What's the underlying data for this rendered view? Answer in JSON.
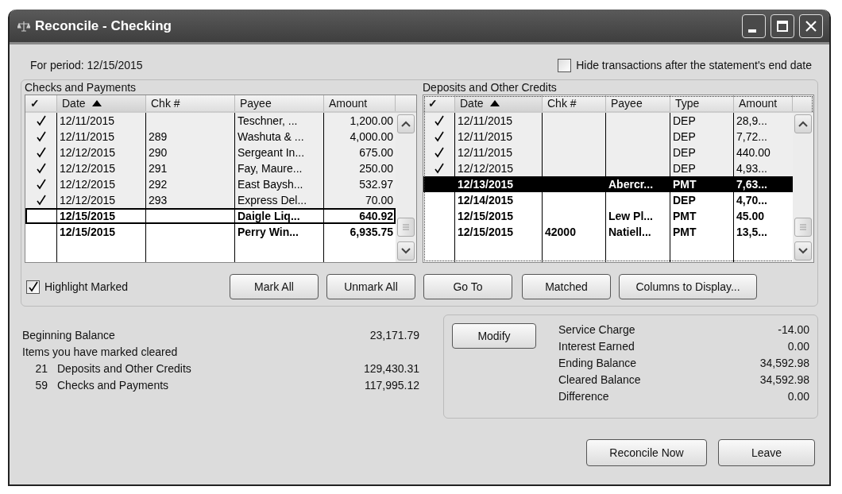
{
  "window": {
    "title": "Reconcile - Checking"
  },
  "period": "For period: 12/15/2015",
  "hide_option": {
    "label": "Hide transactions after the statement's end date",
    "checked": false
  },
  "checks_table": {
    "title": "Checks and Payments",
    "columns": [
      {
        "label": "✓",
        "sorted": false
      },
      {
        "label": "Date",
        "sorted": true
      },
      {
        "label": "Chk #",
        "sorted": false
      },
      {
        "label": "Payee",
        "sorted": false
      },
      {
        "label": "Amount",
        "sorted": false
      }
    ],
    "rows": [
      {
        "cleared": true,
        "selected": false,
        "focused": false,
        "cells": [
          "",
          "12/11/2015",
          "",
          "Teschner, ...",
          "1,200.00"
        ]
      },
      {
        "cleared": true,
        "selected": false,
        "focused": false,
        "cells": [
          "",
          "12/11/2015",
          "289",
          "Washuta & ...",
          "4,000.00"
        ]
      },
      {
        "cleared": true,
        "selected": false,
        "focused": false,
        "cells": [
          "",
          "12/12/2015",
          "290",
          "Sergeant In...",
          "675.00"
        ]
      },
      {
        "cleared": true,
        "selected": false,
        "focused": false,
        "cells": [
          "",
          "12/12/2015",
          "291",
          "Fay, Maure...",
          "250.00"
        ]
      },
      {
        "cleared": true,
        "selected": false,
        "focused": false,
        "cells": [
          "",
          "12/12/2015",
          "292",
          "East Baysh...",
          "532.97"
        ]
      },
      {
        "cleared": true,
        "selected": false,
        "focused": false,
        "cells": [
          "",
          "12/12/2015",
          "293",
          "Express Del...",
          "70.00"
        ]
      },
      {
        "cleared": false,
        "selected": false,
        "focused": true,
        "cells": [
          "",
          "12/15/2015",
          "",
          "Daigle Liq...",
          "640.92"
        ]
      },
      {
        "cleared": false,
        "selected": false,
        "focused": false,
        "cells": [
          "",
          "12/15/2015",
          "",
          "Perry Win...",
          "6,935.75"
        ]
      }
    ]
  },
  "deposits_table": {
    "title": "Deposits and Other Credits",
    "columns": [
      {
        "label": "✓",
        "sorted": false
      },
      {
        "label": "Date",
        "sorted": true
      },
      {
        "label": "Chk #",
        "sorted": false
      },
      {
        "label": "Payee",
        "sorted": false
      },
      {
        "label": "Type",
        "sorted": false
      },
      {
        "label": "Amount",
        "sorted": false
      }
    ],
    "rows": [
      {
        "cleared": true,
        "selected": false,
        "focused": false,
        "cells": [
          "",
          "12/11/2015",
          "",
          "",
          "DEP",
          "28,9..."
        ]
      },
      {
        "cleared": true,
        "selected": false,
        "focused": false,
        "cells": [
          "",
          "12/11/2015",
          "",
          "",
          "DEP",
          "7,72..."
        ]
      },
      {
        "cleared": true,
        "selected": false,
        "focused": false,
        "cells": [
          "",
          "12/11/2015",
          "",
          "",
          "DEP",
          "440.00"
        ]
      },
      {
        "cleared": true,
        "selected": false,
        "focused": false,
        "cells": [
          "",
          "12/12/2015",
          "",
          "",
          "DEP",
          "4,93..."
        ]
      },
      {
        "cleared": false,
        "selected": true,
        "focused": false,
        "cells": [
          "",
          "12/13/2015",
          "",
          "Abercr...",
          "PMT",
          "7,63..."
        ]
      },
      {
        "cleared": false,
        "selected": false,
        "focused": false,
        "cells": [
          "",
          "12/14/2015",
          "",
          "",
          "DEP",
          "4,70..."
        ]
      },
      {
        "cleared": false,
        "selected": false,
        "focused": false,
        "cells": [
          "",
          "12/15/2015",
          "",
          "Lew Pl...",
          "PMT",
          "45.00"
        ]
      },
      {
        "cleared": false,
        "selected": false,
        "focused": false,
        "cells": [
          "",
          "12/15/2015",
          "42000",
          "Natiell...",
          "PMT",
          "13,5..."
        ]
      }
    ]
  },
  "highlight_option": {
    "label": "Highlight Marked",
    "checked": true
  },
  "table_buttons": [
    "Mark All",
    "Unmark All",
    "Go To",
    "Matched",
    "Columns to Display..."
  ],
  "summary": {
    "beginning": {
      "label": "Beginning Balance",
      "value": "23,171.79"
    },
    "marked_heading": "Items you have marked cleared",
    "items": [
      {
        "count": "21",
        "label": "Deposits and Other Credits",
        "value": "129,430.31"
      },
      {
        "count": "59",
        "label": "Checks and Payments",
        "value": "117,995.12"
      }
    ]
  },
  "balances": {
    "button": "Modify",
    "rows": [
      {
        "label": "Service Charge",
        "value": "-14.00"
      },
      {
        "label": "Interest Earned",
        "value": "0.00"
      },
      {
        "label": "Ending Balance",
        "value": "34,592.98"
      },
      {
        "label": "Cleared Balance",
        "value": "34,592.98"
      },
      {
        "label": "Difference",
        "value": "0.00"
      }
    ]
  },
  "footer_buttons": [
    "Reconcile Now",
    "Leave"
  ]
}
